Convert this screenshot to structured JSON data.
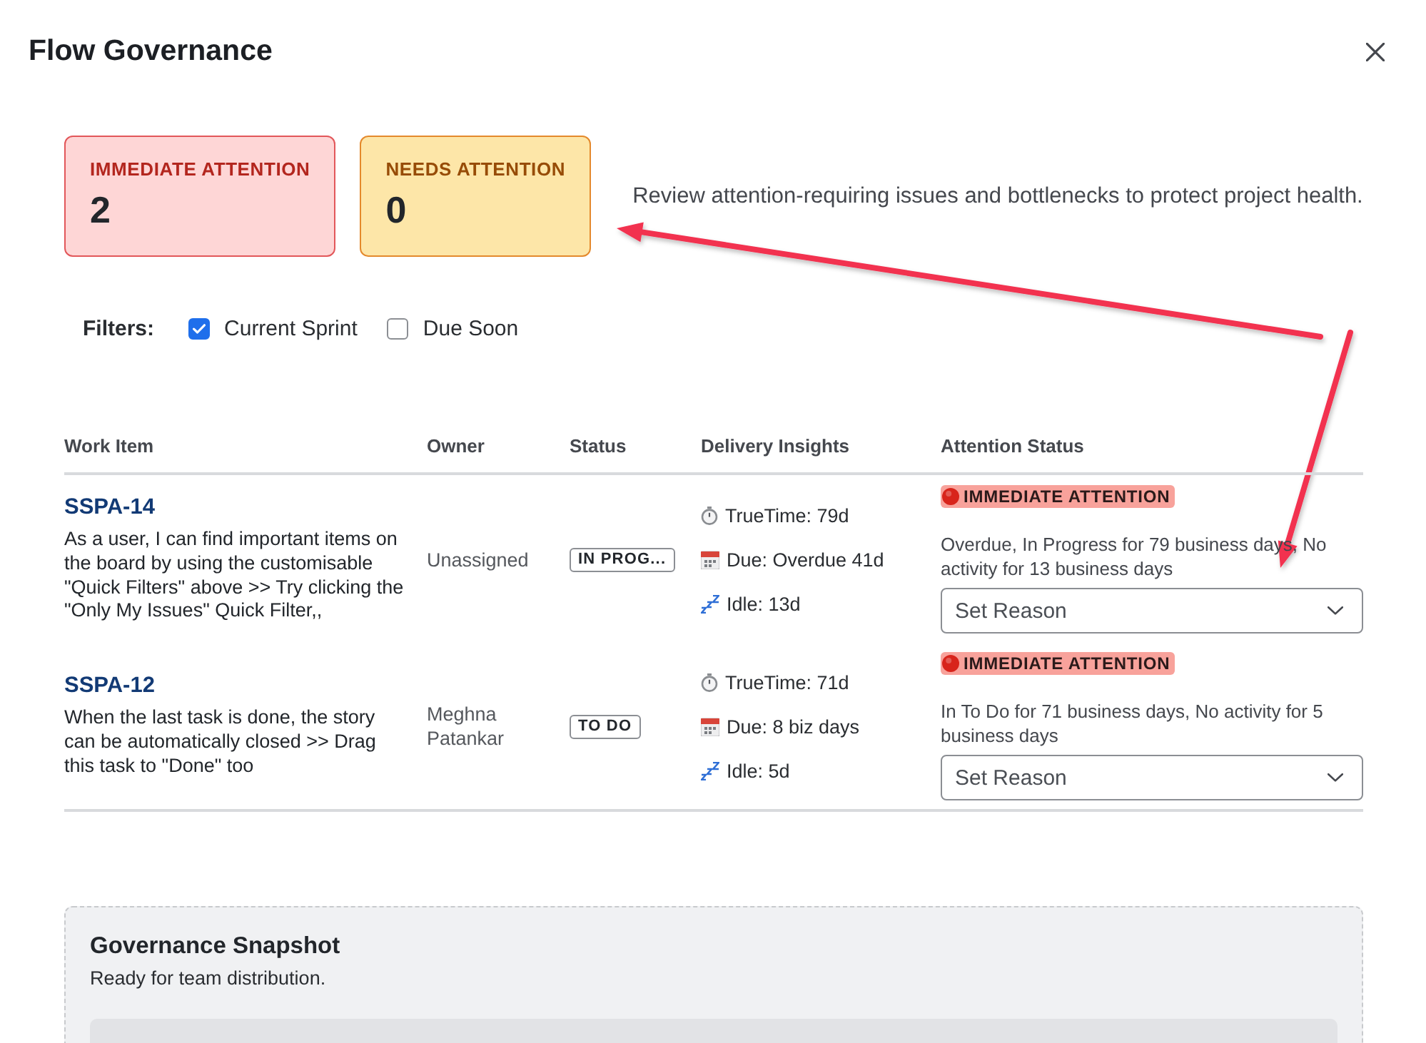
{
  "dialog": {
    "title": "Flow Governance"
  },
  "summary_cards": [
    {
      "kind": "immediate",
      "label": "IMMEDIATE ATTENTION",
      "count": "2"
    },
    {
      "kind": "needs",
      "label": "NEEDS ATTENTION",
      "count": "0"
    }
  ],
  "description": "Review attention-requiring issues and bottlenecks to protect project health.",
  "filters": {
    "label": "Filters:",
    "options": [
      {
        "label": "Current Sprint",
        "checked": true
      },
      {
        "label": "Due Soon",
        "checked": false
      }
    ]
  },
  "table": {
    "columns": [
      "Work Item",
      "Owner",
      "Status",
      "Delivery Insights",
      "Attention Status"
    ],
    "rows": [
      {
        "key": "SSPA-14",
        "summary": "As a user, I can find important items on the board by using the customisable \"Quick Filters\" above >> Try clicking the \"Only My Issues\" Quick Filter,,",
        "owner": "Unassigned",
        "status": "IN PROG...",
        "insights": [
          {
            "kind": "truetime",
            "text": "TrueTime: 79d"
          },
          {
            "kind": "due",
            "text": "Due: Overdue 41d"
          },
          {
            "kind": "idle",
            "text": "Idle: 13d"
          }
        ],
        "attention": {
          "kind": "immediate",
          "label": "IMMEDIATE ATTENTION",
          "detail": "Overdue, In Progress for 79 business days, No activity for 13 business days",
          "reason": {
            "value": "Set Reason"
          }
        }
      },
      {
        "key": "SSPA-12",
        "summary": "When the last task is done, the story can be automatically closed >> Drag this task to \"Done\" too",
        "owner": "Meghna Patankar",
        "status": "TO DO",
        "insights": [
          {
            "kind": "truetime",
            "text": "TrueTime: 71d"
          },
          {
            "kind": "due",
            "text": "Due: 8 biz days"
          },
          {
            "kind": "idle",
            "text": "Idle: 5d"
          }
        ],
        "attention": {
          "kind": "immediate",
          "label": "IMMEDIATE ATTENTION",
          "detail": "In To Do for 71 business days, No activity for 5 business days",
          "reason": {
            "value": "Set Reason"
          }
        }
      }
    ]
  },
  "snapshot": {
    "title": "Governance Snapshot",
    "subtitle": "Ready for team distribution."
  }
}
